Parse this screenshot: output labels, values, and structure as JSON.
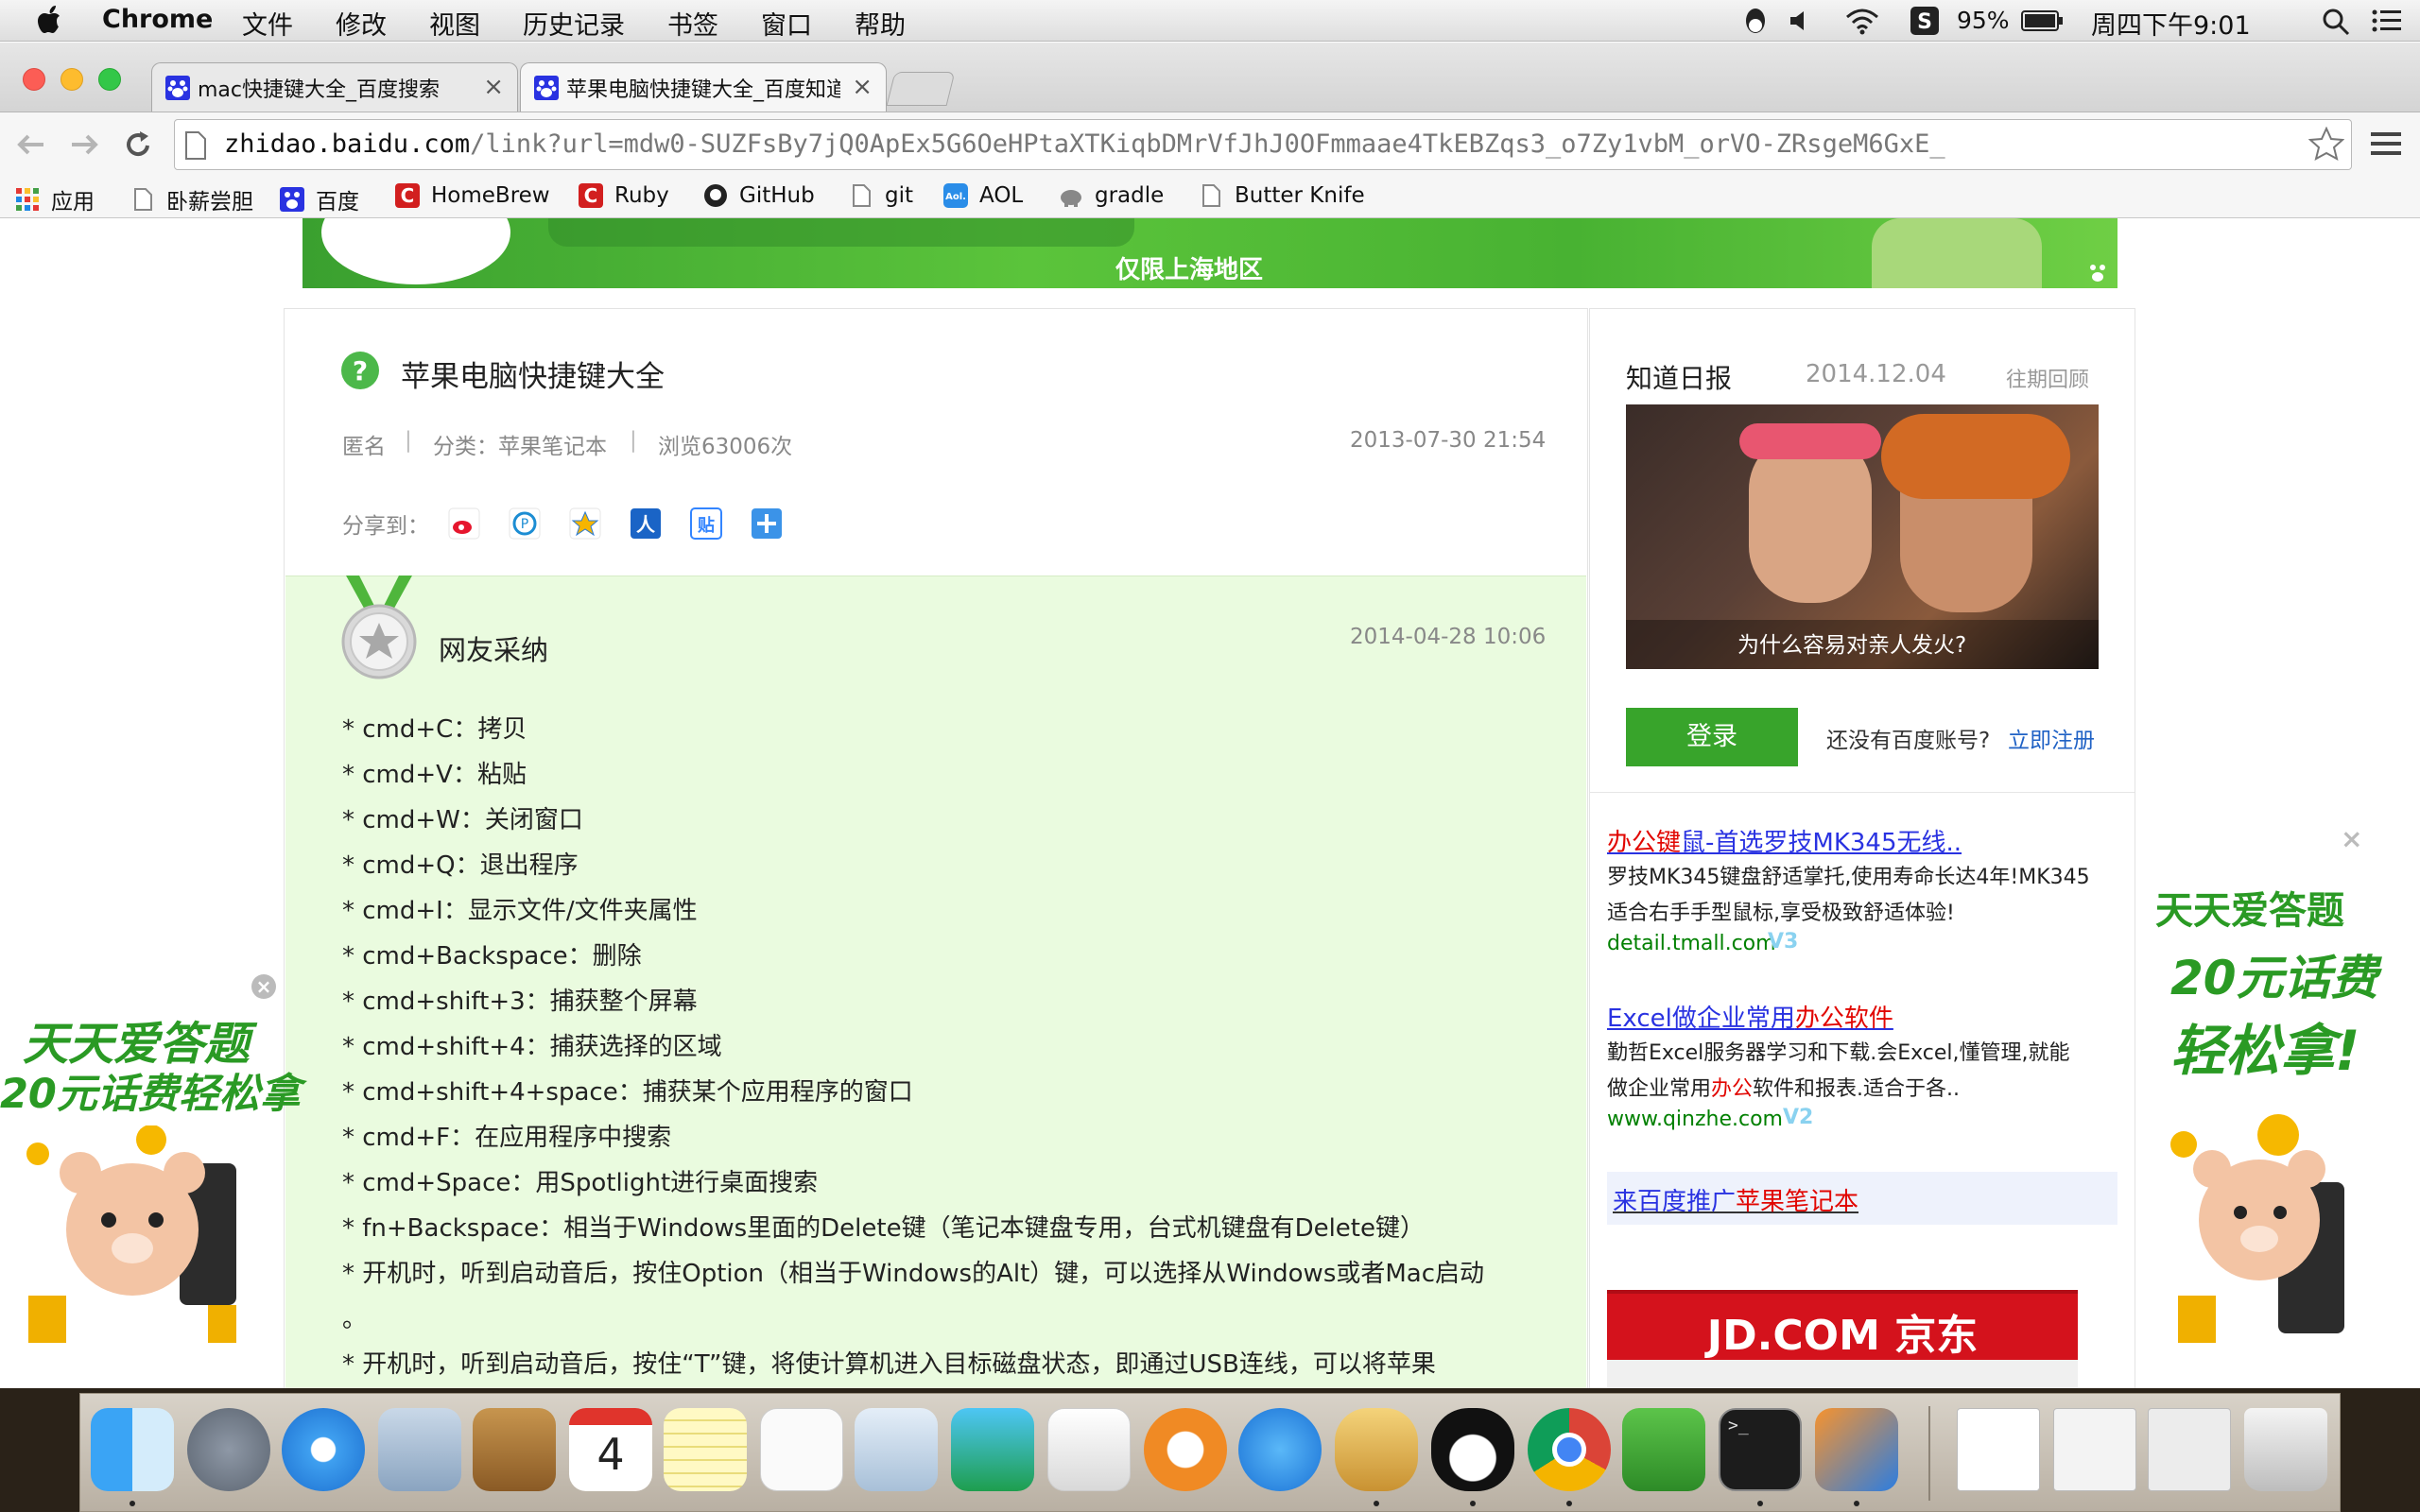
{
  "menubar": {
    "app_name": "Chrome",
    "items": [
      "文件",
      "修改",
      "视图",
      "历史记录",
      "书签",
      "窗口",
      "帮助"
    ],
    "battery": "95%",
    "clock": "周四下午9:01"
  },
  "tabs": [
    {
      "title": "mac快捷键大全_百度搜索",
      "active": false
    },
    {
      "title": "苹果电脑快捷键大全_百度知道",
      "active": true
    }
  ],
  "omnibox": {
    "host": "zhidao.baidu.com",
    "path": "/link?url=mdw0-SUZFsBy7jQ0ApEx5G6OeHPtaXTKiqbDMrVfJhJ0OFmmaae4TkEBZqs3_o7Zy1vbM_orVO-ZRsgeM6GxE_"
  },
  "bookmarks": [
    "应用",
    "卧薪尝胆",
    "百度",
    "HomeBrew",
    "Ruby",
    "GitHub",
    "git",
    "AOL",
    "gradle",
    "Butter Knife"
  ],
  "banner": {
    "region_text": "仅限上海地区"
  },
  "question": {
    "title": "苹果电脑快捷键大全",
    "author": "匿名",
    "sep": "|",
    "category": "分类：苹果笔记本",
    "views": "浏览63006次",
    "date": "2013-07-30 21:54",
    "share_label": "分享到："
  },
  "answer": {
    "label": "网友采纳",
    "date": "2014-04-28 10:06",
    "lines": [
      "* cmd+C：拷贝",
      "* cmd+V：粘贴",
      "* cmd+W：关闭窗口",
      "* cmd+Q：退出程序",
      "* cmd+I：显示文件/文件夹属性",
      "* cmd+Backspace：删除",
      "* cmd+shift+3：捕获整个屏幕",
      "* cmd+shift+4：捕获选择的区域",
      "* cmd+shift+4+space：捕获某个应用程序的窗口",
      "* cmd+F：在应用程序中搜索",
      "* cmd+Space：用Spotlight进行桌面搜索",
      "* fn+Backspace：相当于Windows里面的Delete键（笔记本键盘专用，台式机键盘有Delete键）",
      "* 开机时，听到启动音后，按住Option（相当于Windows的Alt）键，可以选择从Windows或者Mac启动",
      "。",
      "* 开机时，听到启动音后，按住“T”键，将使计算机进入目标磁盘状态，即通过USB连线，可以将苹果"
    ]
  },
  "sidebar": {
    "daily_title": "知道日报",
    "daily_date": "2014.12.04",
    "past_link": "往期回顾",
    "image_caption": "为什么容易对亲人发火?",
    "login_button": "登录",
    "no_account": "还没有百度账号?",
    "register_link": "立即注册",
    "ads": [
      {
        "title_a": "办公键",
        "title_b": "鼠-首选罗技MK345无线..",
        "desc1": "罗技MK345键盘舒适掌托,使用寿命长达4年!MK345",
        "desc2": "适合右手手型鼠标,享受极致舒适体验!",
        "url": "detail.tmall.com",
        "badge": "V3"
      },
      {
        "title_a": "Excel做企业常用",
        "title_b": "办公软件",
        "desc1": "勤哲Excel服务器学习和下载.会Excel,懂管理,就能",
        "desc2_a": "做企业常用",
        "desc2_b": "办公",
        "desc2_c": "软件和报表.适合于各..",
        "url": "www.qinzhe.com",
        "badge": "V2"
      }
    ],
    "promo_a": "来百度推广",
    "promo_b": "苹果笔记本",
    "jd_text": "JD.COM 京东"
  },
  "float_ads": {
    "left_line1": "天天爱答题",
    "left_line2": "20元话费轻松拿",
    "right_line1": "天天爱答题",
    "right_line2": "20元话费",
    "right_line3": "轻松拿!",
    "close": "×"
  },
  "colors": {
    "baidu_blue": "#2932e1",
    "green_button": "#38a42b",
    "answer_bg": "#eafbdf",
    "red_link": "#e10601"
  }
}
